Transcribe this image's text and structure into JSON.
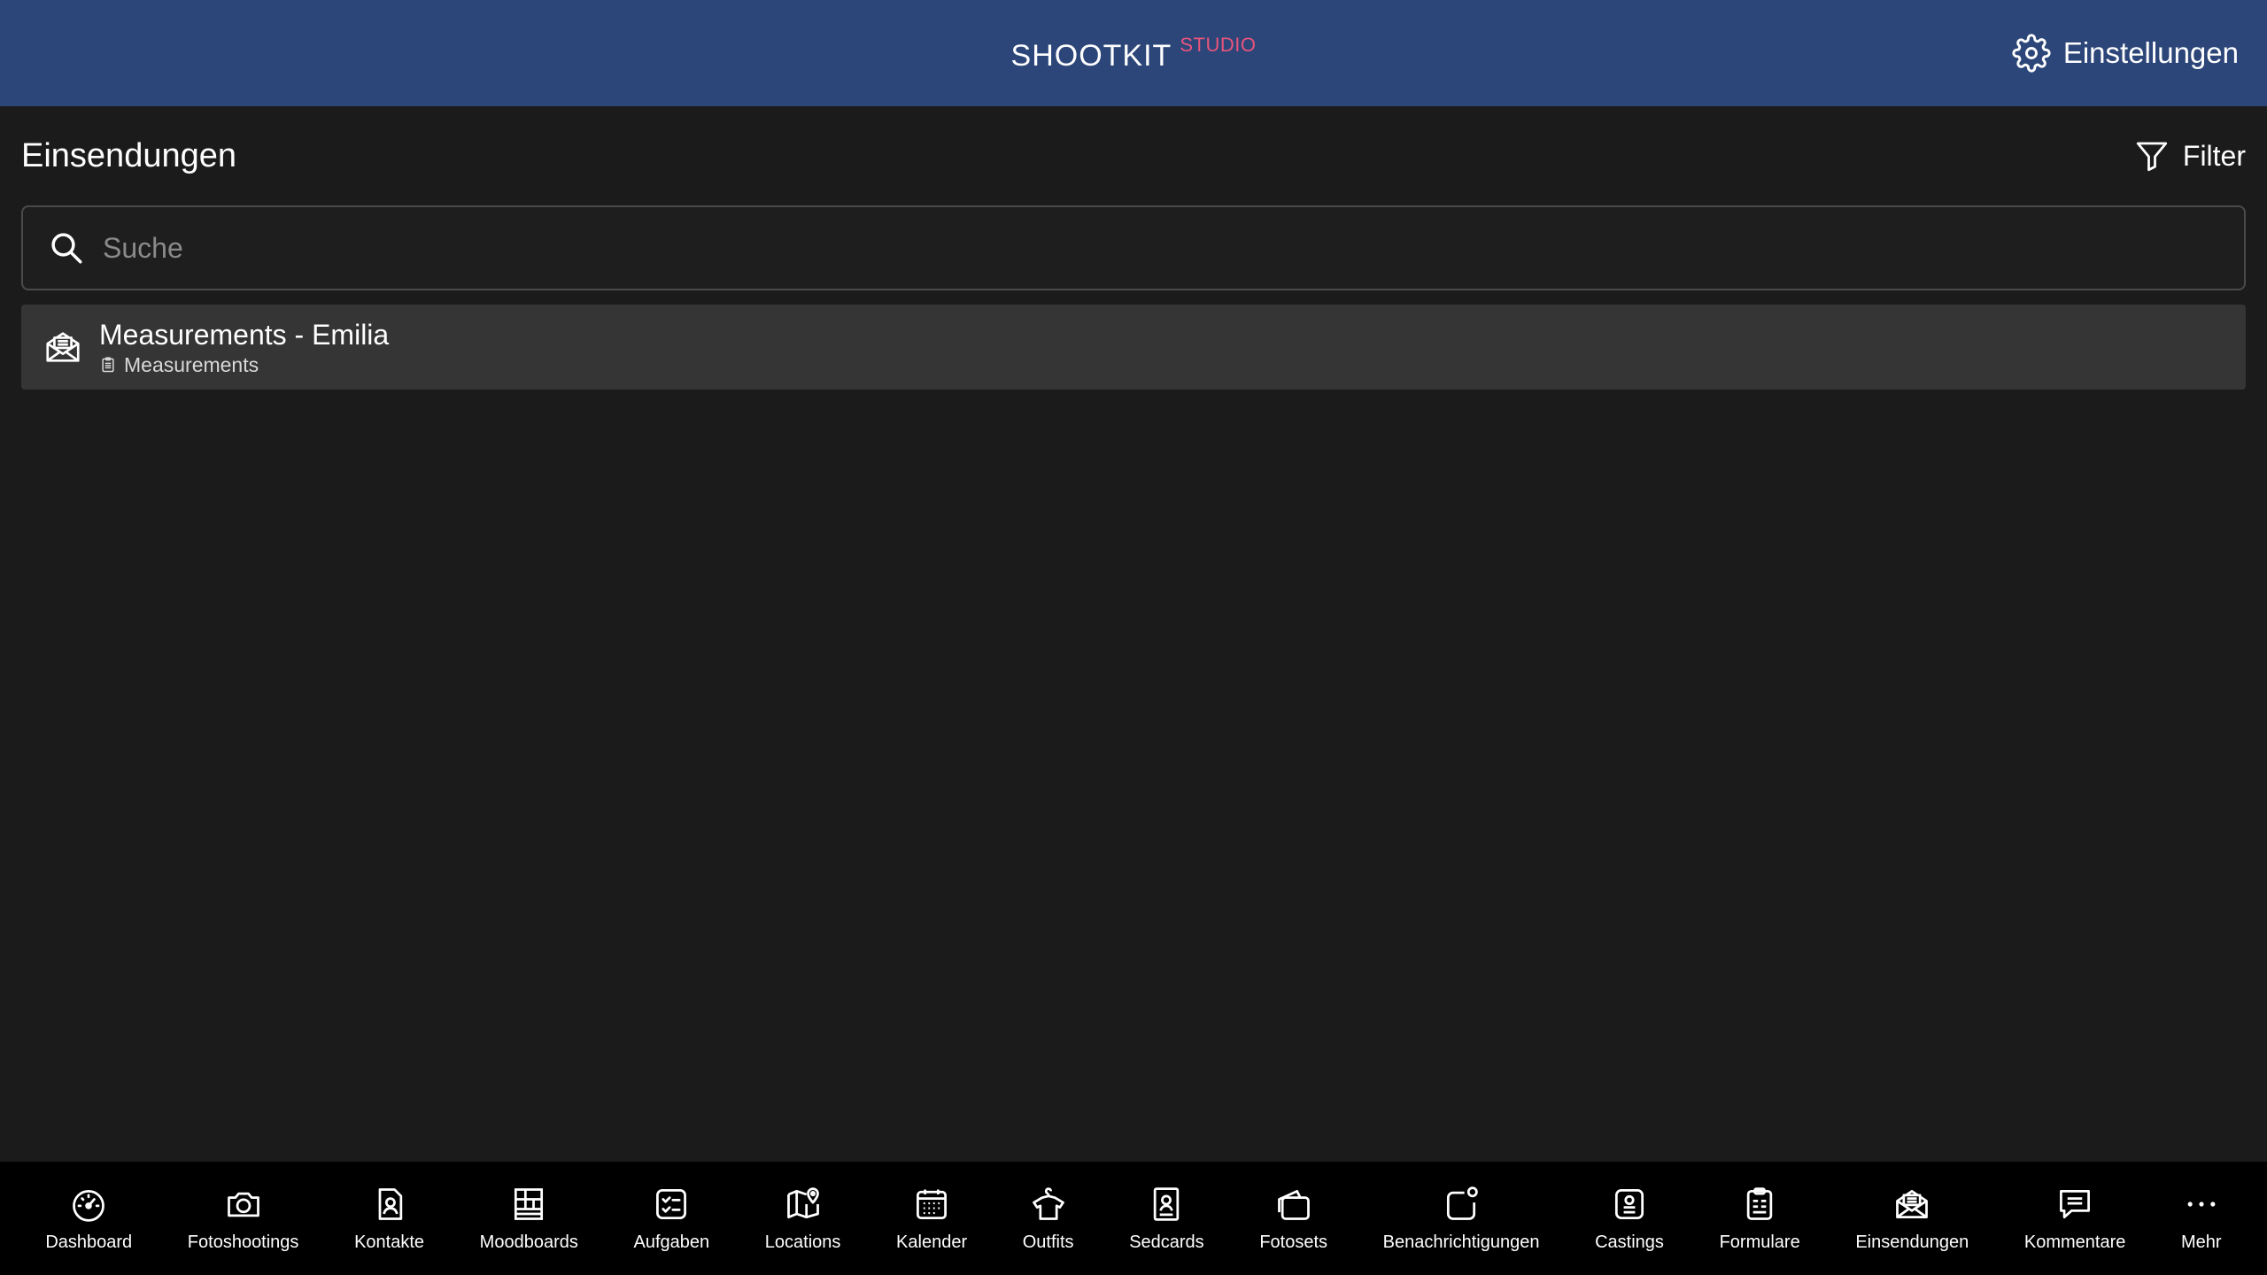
{
  "header": {
    "brand_main": "SHOOTKIT",
    "brand_sup": "STUDIO",
    "settings_label": "Einstellungen"
  },
  "page": {
    "title": "Einsendungen",
    "filter_label": "Filter"
  },
  "search": {
    "placeholder": "Suche",
    "value": ""
  },
  "list": {
    "items": [
      {
        "title": "Measurements - Emilia",
        "subtitle": "Measurements"
      }
    ]
  },
  "tabbar": {
    "items": [
      {
        "label": "Dashboard",
        "icon": "gauge-icon"
      },
      {
        "label": "Fotoshootings",
        "icon": "camera-icon"
      },
      {
        "label": "Kontakte",
        "icon": "contact-card-icon"
      },
      {
        "label": "Moodboards",
        "icon": "grid-board-icon"
      },
      {
        "label": "Aufgaben",
        "icon": "checklist-icon"
      },
      {
        "label": "Locations",
        "icon": "map-pin-icon"
      },
      {
        "label": "Kalender",
        "icon": "calendar-icon"
      },
      {
        "label": "Outfits",
        "icon": "shirt-hanger-icon"
      },
      {
        "label": "Sedcards",
        "icon": "profile-card-icon"
      },
      {
        "label": "Fotosets",
        "icon": "photo-stack-icon"
      },
      {
        "label": "Benachrichtigungen",
        "icon": "notification-icon"
      },
      {
        "label": "Castings",
        "icon": "id-badge-icon"
      },
      {
        "label": "Formulare",
        "icon": "clipboard-icon"
      },
      {
        "label": "Einsendungen",
        "icon": "envelope-open-icon"
      },
      {
        "label": "Kommentare",
        "icon": "comment-icon"
      },
      {
        "label": "Mehr",
        "icon": "more-dots-icon"
      }
    ]
  }
}
